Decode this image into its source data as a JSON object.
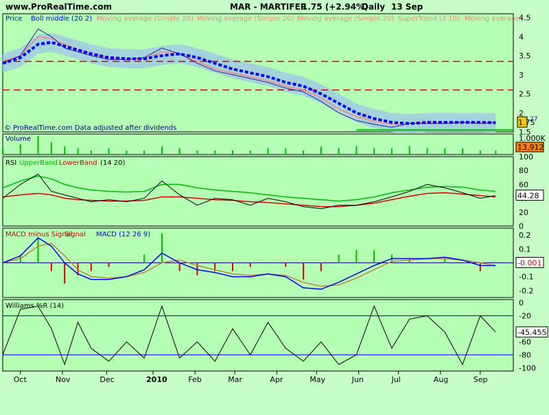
{
  "header": {
    "site": "www.ProRealTime.com",
    "symbol": "MAR - MARTIFER",
    "change": "1.75 (+2.94%)",
    "period": "Daily",
    "date": "13 Sep"
  },
  "colors": {
    "background": "#c8ffc8",
    "plot": "#b4ffb4",
    "blue": "#0000ff",
    "red": "#dd0000",
    "green": "#00bb00",
    "band": "#a0c8e6",
    "salmon": "#ff8080"
  },
  "chart_data": [
    {
      "type": "line",
      "panel": "price",
      "legend": [
        "Price",
        "Boll middle (20 2)",
        "Moving average (Simple 20)",
        "Moving average (Simple 20)",
        "Moving average (Simple 20)",
        "SuperTrend (3 10)",
        "Moving average"
      ],
      "note": "© ProRealTime.com Data adjusted after dividends",
      "ylim": [
        1.5,
        4.6
      ],
      "yticks": [
        "4.5",
        "4",
        "3.5",
        "3",
        "2.5",
        "2",
        "1.5"
      ],
      "x": [
        0,
        8,
        16,
        22,
        28,
        34,
        40,
        48,
        56,
        64,
        72,
        80,
        88,
        96,
        104,
        112,
        120,
        128,
        136,
        144,
        152,
        160,
        168,
        176,
        184,
        192,
        200,
        208,
        216,
        223
      ],
      "price": [
        3.3,
        3.5,
        4.2,
        4.0,
        3.7,
        3.6,
        3.5,
        3.4,
        3.4,
        3.45,
        3.7,
        3.55,
        3.3,
        3.1,
        3.0,
        2.9,
        2.8,
        2.65,
        2.55,
        2.3,
        2.0,
        1.8,
        1.7,
        1.62,
        1.72,
        1.72,
        1.72,
        1.75,
        1.72,
        1.75
      ],
      "boll_middle": [
        3.3,
        3.45,
        3.8,
        3.85,
        3.75,
        3.65,
        3.55,
        3.45,
        3.42,
        3.42,
        3.5,
        3.55,
        3.45,
        3.3,
        3.15,
        3.05,
        2.95,
        2.8,
        2.7,
        2.5,
        2.25,
        2.0,
        1.85,
        1.75,
        1.72,
        1.75,
        1.75,
        1.75,
        1.75,
        1.74
      ],
      "moving_average": [
        3.35,
        3.5,
        4.0,
        3.95,
        3.8,
        3.65,
        3.55,
        3.45,
        3.4,
        3.42,
        3.6,
        3.55,
        3.35,
        3.15,
        3.05,
        2.95,
        2.85,
        2.7,
        2.6,
        2.4,
        2.1,
        1.9,
        1.78,
        1.7,
        1.72,
        1.75,
        1.73,
        1.75,
        1.74,
        1.76
      ],
      "last": "1.75",
      "last_box": "27",
      "hlines": [
        3.35,
        2.6
      ]
    },
    {
      "type": "bar",
      "panel": "volume",
      "legend": [
        "Volume"
      ],
      "ylim": [
        0,
        1.0
      ],
      "yticks": [
        "1.000K"
      ],
      "last": "13,912",
      "x": [
        0,
        8,
        16,
        22,
        28,
        34,
        40,
        48,
        56,
        64,
        72,
        80,
        88,
        96,
        104,
        112,
        120,
        128,
        136,
        144,
        152,
        160,
        168,
        176,
        184,
        192,
        200,
        208,
        216,
        223
      ],
      "values": [
        0.3,
        0.5,
        0.9,
        0.6,
        0.4,
        0.3,
        0.2,
        0.3,
        0.2,
        0.2,
        0.4,
        0.3,
        0.2,
        0.2,
        0.2,
        0.2,
        0.3,
        0.3,
        0.2,
        0.4,
        0.3,
        0.4,
        0.3,
        0.3,
        0.4,
        0.3,
        0.3,
        0.3,
        0.2,
        0.2
      ]
    },
    {
      "type": "line",
      "panel": "rsi",
      "legend": [
        "RSI",
        "UpperBand",
        "LowerBand",
        "(14 20)"
      ],
      "ylim": [
        0,
        100
      ],
      "yticks": [
        "100",
        "80",
        "60",
        "40",
        "20",
        "0"
      ],
      "last": "44.28",
      "x": [
        0,
        8,
        16,
        22,
        28,
        34,
        40,
        48,
        56,
        64,
        72,
        80,
        88,
        96,
        104,
        112,
        120,
        128,
        136,
        144,
        152,
        160,
        168,
        176,
        184,
        192,
        200,
        208,
        216,
        223
      ],
      "rsi": [
        40,
        60,
        75,
        50,
        45,
        40,
        35,
        38,
        35,
        40,
        65,
        45,
        30,
        40,
        38,
        30,
        40,
        35,
        28,
        25,
        30,
        30,
        35,
        42,
        50,
        60,
        55,
        48,
        40,
        44
      ],
      "upper": [
        55,
        65,
        72,
        68,
        60,
        55,
        52,
        50,
        49,
        50,
        60,
        60,
        55,
        52,
        50,
        48,
        45,
        42,
        40,
        38,
        36,
        38,
        42,
        48,
        52,
        56,
        57,
        56,
        52,
        50
      ],
      "lower": [
        42,
        45,
        47,
        45,
        40,
        38,
        37,
        36,
        36,
        37,
        42,
        42,
        40,
        38,
        37,
        35,
        34,
        32,
        30,
        28,
        28,
        30,
        33,
        38,
        43,
        47,
        48,
        46,
        44,
        42
      ]
    },
    {
      "type": "line",
      "panel": "macd",
      "legend": [
        "MACD minus Signal",
        "Signal",
        "MACD (12 26 9)"
      ],
      "ylim": [
        -0.25,
        0.25
      ],
      "yticks": [
        "0.2",
        "0.1",
        "0",
        "-0.1",
        "-0.2"
      ],
      "last": "-0.001",
      "x": [
        0,
        8,
        16,
        22,
        28,
        34,
        40,
        48,
        56,
        64,
        72,
        80,
        88,
        96,
        104,
        112,
        120,
        128,
        136,
        144,
        152,
        160,
        168,
        176,
        184,
        192,
        200,
        208,
        216,
        223
      ],
      "macd": [
        0.0,
        0.05,
        0.18,
        0.12,
        0.0,
        -0.08,
        -0.12,
        -0.12,
        -0.1,
        -0.05,
        0.07,
        0.0,
        -0.05,
        -0.07,
        -0.1,
        -0.1,
        -0.08,
        -0.1,
        -0.18,
        -0.19,
        -0.14,
        -0.08,
        -0.02,
        0.03,
        0.03,
        0.03,
        0.04,
        0.02,
        -0.02,
        -0.02
      ],
      "signal": [
        0.0,
        0.03,
        0.12,
        0.14,
        0.05,
        -0.05,
        -0.1,
        -0.11,
        -0.1,
        -0.07,
        0.0,
        0.02,
        -0.02,
        -0.05,
        -0.08,
        -0.09,
        -0.08,
        -0.09,
        -0.14,
        -0.17,
        -0.16,
        -0.11,
        -0.05,
        0.01,
        0.02,
        0.03,
        0.03,
        0.02,
        0.0,
        -0.02
      ]
    },
    {
      "type": "line",
      "panel": "williams",
      "legend": [
        "Williams %R (14)"
      ],
      "ylim": [
        -105,
        5
      ],
      "yticks": [
        "0",
        "-20",
        "-60",
        "-80",
        "-100"
      ],
      "last": "-45.455",
      "x": [
        0,
        8,
        16,
        22,
        28,
        34,
        40,
        48,
        56,
        64,
        72,
        80,
        88,
        96,
        104,
        112,
        120,
        128,
        136,
        144,
        152,
        160,
        168,
        176,
        184,
        192,
        200,
        208,
        216,
        223
      ],
      "values": [
        -80,
        -10,
        -5,
        -40,
        -95,
        -30,
        -70,
        -90,
        -60,
        -85,
        -5,
        -85,
        -60,
        -90,
        -40,
        -80,
        -30,
        -70,
        -90,
        -60,
        -95,
        -80,
        -5,
        -70,
        -25,
        -20,
        -45,
        -95,
        -20,
        -45
      ]
    }
  ],
  "xaxis": {
    "labels": [
      "Oct",
      "Nov",
      "Dec",
      "2010",
      "Feb",
      "Mar",
      "Apr",
      "May",
      "Jun",
      "Jul",
      "Aug",
      "Sep"
    ],
    "positions": [
      8,
      27,
      47,
      68,
      87,
      105,
      124,
      142,
      161,
      179,
      198,
      216
    ]
  }
}
